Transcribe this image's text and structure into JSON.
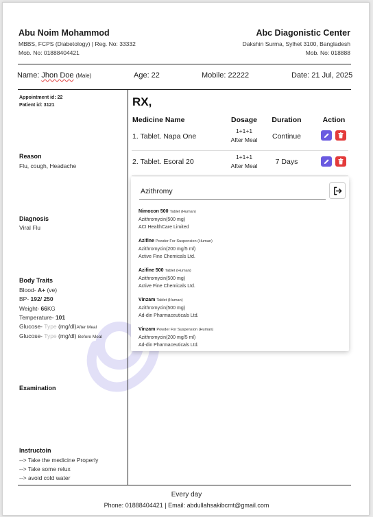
{
  "doctor": {
    "name": "Abu Noim Mohammod",
    "degrees": "MBBS, FCPS (Diabetology) | Reg. No: 33332",
    "mobile": "Mob. No: 01888404421"
  },
  "clinic": {
    "name": "Abc Diagonistic Center",
    "address": "Dakshin Surma, Sylhet 3100, Bangladesh",
    "mobile": "Mob. No: 018888"
  },
  "patient": {
    "name_label": "Name:",
    "name": "Jhon Doe",
    "gender": "(Male)",
    "age_label": "Age:",
    "age": "22",
    "mobile_label": "Mobile:",
    "mobile": "22222",
    "date_label": "Date:",
    "date": "21 Jul, 2025"
  },
  "ids": {
    "appointment_label": "Appointment id:",
    "appointment": "22",
    "patient_label": "Patient id:",
    "patient": "3121"
  },
  "sections": {
    "reason_title": "Reason",
    "reason": "Flu, cough, Headache",
    "diagnosis_title": "Diagnosis",
    "diagnosis": "Viral Flu",
    "traits_title": "Body Traits",
    "examination_title": "Examination",
    "instruction_title": "Instructoin"
  },
  "traits": {
    "blood_label": "Blood-",
    "blood": "A+",
    "blood_unit": "(ve)",
    "bp_label": "BP-",
    "bp": "192/ 250",
    "weight_label": "Weight-",
    "weight": "66",
    "weight_unit": "KG",
    "temp_label": "Temperature-",
    "temp": "101",
    "glucose_label": "Glucose-",
    "glucose_placeholder": "Type",
    "glucose_unit": "(mg/dl)",
    "after_meal": "After Meal",
    "before_meal": "Before Meal"
  },
  "instructions": [
    "--> Take the medicine Properly",
    "--> Take some relux",
    "--> avoid cold water"
  ],
  "rx": {
    "title": "RX,",
    "headers": {
      "medicine": "Medicine Name",
      "dosage": "Dosage",
      "duration": "Duration",
      "action": "Action"
    },
    "rows": [
      {
        "name": "1. Tablet. Napa One",
        "dose": "1+1+1",
        "meal": "After Meal",
        "duration": "Continue"
      },
      {
        "name": "2. Tablet. Esoral 20",
        "dose": "1+1+1",
        "meal": "After Meal",
        "duration": "7 Days"
      }
    ]
  },
  "search": {
    "value": "Azithromy",
    "results": [
      {
        "name": "Nimocon 500",
        "type": "Tablet (Human)",
        "generic": "Azithromycin(500 mg)",
        "company": "ACI HealthCare Limited"
      },
      {
        "name": "Azifine",
        "type": "Powder For Suspension (Human)",
        "generic": "Azithromycin(200 mg/5 ml)",
        "company": "Active Fine Chemicals Ltd."
      },
      {
        "name": "Azifine 500",
        "type": "Tablet (Human)",
        "generic": "Azithromycin(500 mg)",
        "company": "Active Fine Chemicals Ltd."
      },
      {
        "name": "Vinzam",
        "type": "Tablet (Human)",
        "generic": "Azithromycin(500 mg)",
        "company": "Ad-din Pharmaceuticals Ltd."
      },
      {
        "name": "Vinzam",
        "type": "Powder For Suspension (Human)",
        "generic": "Azithromycin(200 mg/5 ml)",
        "company": "Ad-din Pharmaceuticals Ltd."
      }
    ]
  },
  "footer": {
    "line1": "Every day",
    "phone_label": "Phone:",
    "phone": "01888404421",
    "email_label": "| Email:",
    "email": "abdullahsakibcmt@gmail.com"
  },
  "colors": {
    "edit": "#6a5ae0",
    "delete": "#e33b3b",
    "watermark": "#5b4fd6"
  },
  "icons": {
    "edit": "pencil-icon",
    "delete": "trash-icon",
    "exit": "sign-out-icon",
    "watermark": "stethoscope-icon"
  }
}
